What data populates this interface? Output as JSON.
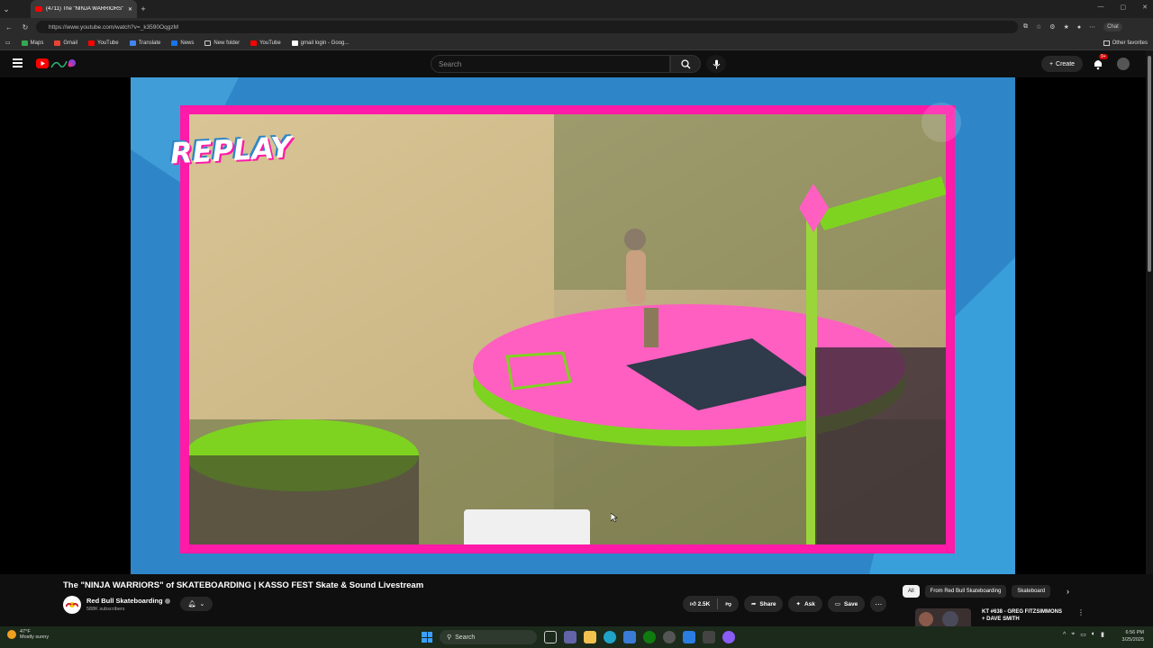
{
  "browser": {
    "tab_title": "(4711) The \"NINJA WARRIORS\" of SKATEBOARDING | KASSO FEST Skate & Sound Livestream",
    "url": "https://www.youtube.com/watch?v=_k3590OqgzM",
    "chat_label": "Chat",
    "bookmarks": [
      {
        "label": "Maps",
        "icon": "maps-icon"
      },
      {
        "label": "Gmail",
        "icon": "gmail-icon"
      },
      {
        "label": "YouTube",
        "icon": "youtube-icon"
      },
      {
        "label": "Translate",
        "icon": "translate-icon"
      },
      {
        "label": "News",
        "icon": "news-icon"
      },
      {
        "label": "New folder",
        "icon": "folder-icon"
      },
      {
        "label": "YouTube",
        "icon": "youtube-icon"
      },
      {
        "label": "gmail login - Goog...",
        "icon": "google-icon"
      }
    ],
    "other_favorites": "Other favorites"
  },
  "youtube": {
    "search_placeholder": "Search",
    "create_label": "Create",
    "notification_count": "9+"
  },
  "video": {
    "overlay_text": "REPLAY",
    "title": "The \"NINJA WARRIORS\" of SKATEBOARDING | KASSO FEST Skate & Sound Livestream",
    "channel": "Red Bull Skateboarding",
    "subscribers": "588K subscribers",
    "likes": "2.5K",
    "share_label": "Share",
    "ask_label": "Ask",
    "save_label": "Save"
  },
  "sidebar": {
    "chips": [
      "All",
      "From Red Bull Skateboarding",
      "Skateboard"
    ],
    "recommended": {
      "title_line1": "KT #638 - GREG FITZSIMMONS",
      "title_line2": "+ DAVE SMITH"
    }
  },
  "taskbar": {
    "temp": "47°F",
    "weather": "Mostly sunny",
    "search_label": "Search",
    "time": "6:56 PM",
    "date": "3/25/2025"
  },
  "colors": {
    "youtube_red": "#ff0000",
    "frame_pink": "#ff1aa8",
    "ramp_green": "#7ed321",
    "bg_blue": "#2e86c8"
  }
}
